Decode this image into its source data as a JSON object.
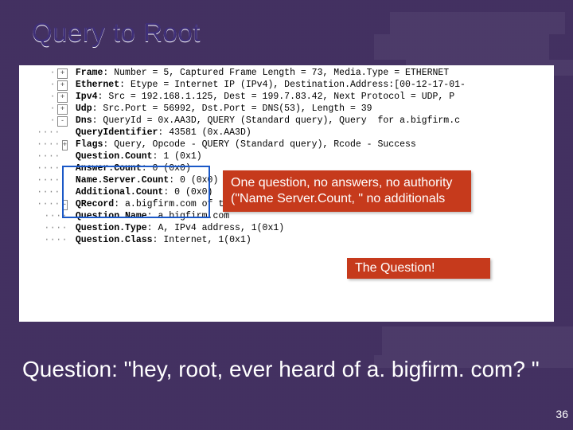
{
  "title": "Query to Root",
  "rows": [
    {
      "indent": 0,
      "toggle": "+",
      "key": "Frame",
      "rest": "Number = 5, Captured Frame Length = 73, Media.Type = ETHERNET"
    },
    {
      "indent": 0,
      "toggle": "+",
      "key": "Ethernet",
      "rest": "Etype = Internet IP (IPv4), Destination.Address:[00-12-17-01-"
    },
    {
      "indent": 0,
      "toggle": "+",
      "key": "Ipv4",
      "rest": "Src = 192.168.1.125, Dest = 199.7.83.42, Next Protocol = UDP, P"
    },
    {
      "indent": 0,
      "toggle": "+",
      "key": "Udp",
      "rest": "Src.Port = 56992, Dst.Port = DNS(53), Length = 39"
    },
    {
      "indent": 0,
      "toggle": "-",
      "key": "Dns",
      "rest": "QueryId = 0x.AA3D, QUERY (Standard query), Query  for a.bigfirm.c"
    },
    {
      "indent": 1,
      "toggle": "",
      "key": "QueryIdentifier",
      "rest": "43581 (0x.AA3D)"
    },
    {
      "indent": 1,
      "toggle": "+",
      "key": "Flags",
      "rest": "Query, Opcode - QUERY (Standard query), Rcode - Success"
    },
    {
      "indent": 1,
      "toggle": "",
      "key": "Question.Count",
      "rest": "1 (0x1)"
    },
    {
      "indent": 1,
      "toggle": "",
      "key": "Answer.Count",
      "rest": "0 (0x0)"
    },
    {
      "indent": 1,
      "toggle": "",
      "key": "Name.Server.Count",
      "rest": "0 (0x0)"
    },
    {
      "indent": 1,
      "toggle": "",
      "key": "Additional.Count",
      "rest": "0 (0x0)"
    },
    {
      "indent": 1,
      "toggle": "-",
      "key": "QRecord",
      "rest": "a.bigfirm.com of type Host Addr on class Internet"
    },
    {
      "indent": 2,
      "toggle": "",
      "key": "Question.Name",
      "rest": "a.bigfirm.com"
    },
    {
      "indent": 2,
      "toggle": "",
      "key": "Question.Type",
      "rest": "A, IPv4 address, 1(0x1)"
    },
    {
      "indent": 2,
      "toggle": "",
      "key": "Question.Class",
      "rest": "Internet, 1(0x1)"
    }
  ],
  "callouts": {
    "counts_box": "One question, no answers, no authority (\"Name Server.Count, \" no additionals",
    "question_label": "The Question!"
  },
  "footer_question": "Question:  \"hey, root, ever heard of a. bigfirm. com? \"",
  "page_number": "36"
}
